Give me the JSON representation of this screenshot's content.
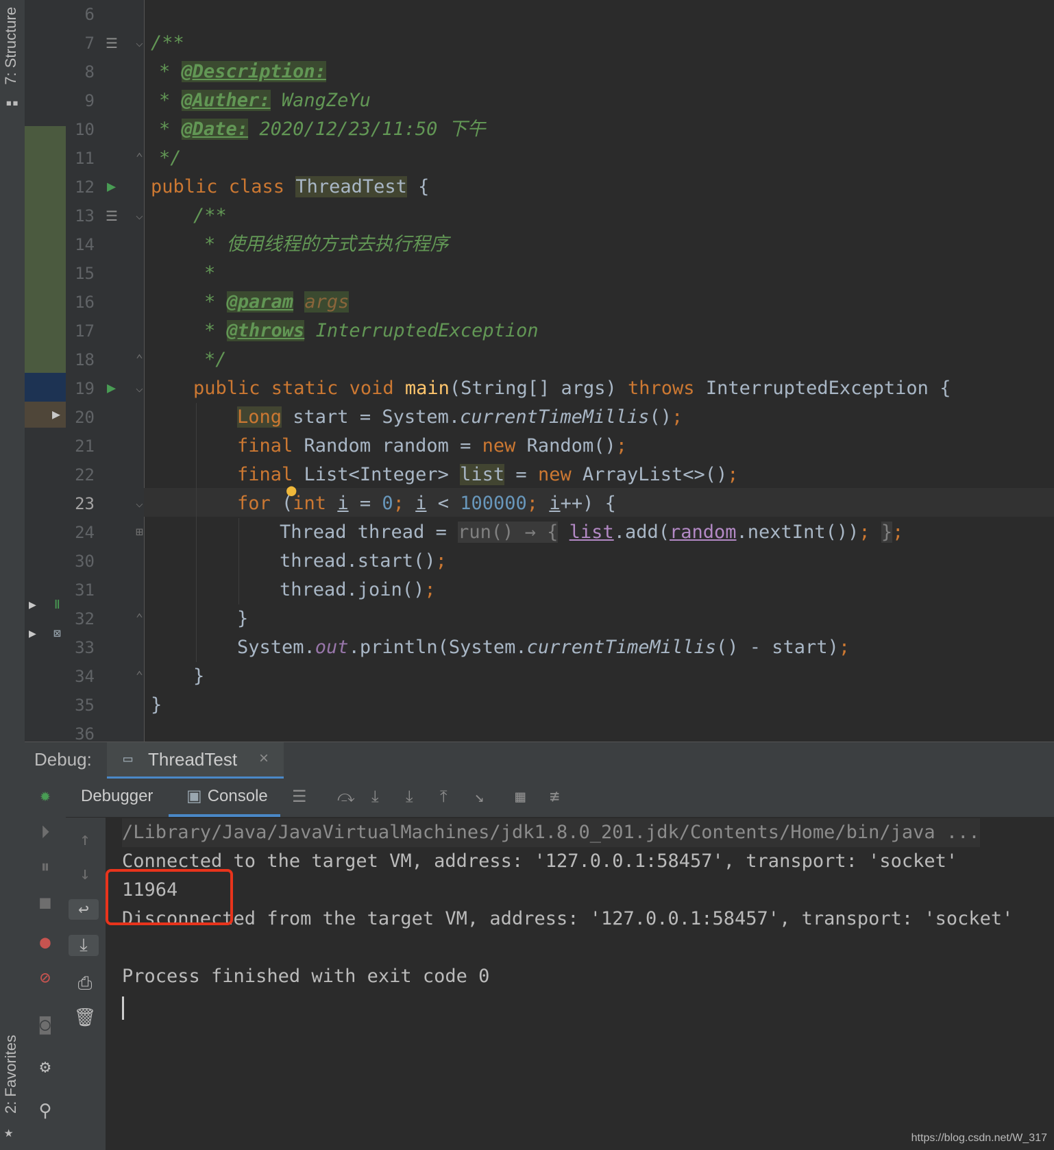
{
  "sidebar": {
    "structure_label": "7: Structure",
    "favorites_label": "2: Favorites"
  },
  "editor": {
    "line_numbers": [
      "6",
      "7",
      "8",
      "9",
      "10",
      "11",
      "12",
      "13",
      "14",
      "15",
      "16",
      "17",
      "18",
      "19",
      "20",
      "21",
      "22",
      "23",
      "24",
      "30",
      "31",
      "32",
      "33",
      "34",
      "35",
      "36"
    ],
    "current_line": "23",
    "code": {
      "l7": "/**",
      "l8_tag": "@Description:",
      "l9_tag": "@Auther:",
      "l9_val": "WangZeYu",
      "l10_tag": "@Date:",
      "l10_val": "2020/12/23/11:50 下午",
      "l11": "*/",
      "l12_kw": "public class",
      "l12_name": "ThreadTest",
      "l13": "/**",
      "l14": "* 使用线程的方式去执行程序",
      "l15": "*",
      "l16_tag": "@param",
      "l16_val": "args",
      "l17_tag": "@throws",
      "l17_val": "InterruptedException",
      "l18": "*/",
      "l19_kw": "public static void",
      "l19_fn": "main",
      "l19_sig": "(String[] args)",
      "l19_throws": "throws",
      "l19_exc": "InterruptedException {",
      "l20_type": "Long",
      "l20_rest": " start = System.",
      "l20_call": "currentTimeMillis",
      "l20_end": "()",
      "l21_kw": "final",
      "l21_mid": " Random random = ",
      "l21_new": "new",
      "l21_end": " Random()",
      "l22_kw": "final",
      "l22_mid": " List<Integer> ",
      "l22_var": "list",
      "l22_eq": " = ",
      "l22_new": "new",
      "l22_end": " ArrayList<>()",
      "l23_for": "for",
      "l23_int": "int",
      "l23_i": "i",
      "l23_zero": "0",
      "l23_max": "100000",
      "l24_a": "Thread thread = ",
      "l24_lambda": "run() → {",
      "l24_list": "list",
      "l24_add": ".add(",
      "l24_random": "random",
      "l24_next": ".nextInt())",
      "l24_close": "}",
      "l30": "thread.start()",
      "l31": "thread.join()",
      "l32": "}",
      "l33_a": "System.",
      "l33_out": "out",
      "l33_b": ".println(System.",
      "l33_call": "currentTimeMillis",
      "l33_c": "() - start)",
      "l34": "}",
      "l35": "}"
    }
  },
  "debug": {
    "label": "Debug:",
    "tab_title": "ThreadTest",
    "tab_close": "×",
    "subtabs": {
      "debugger": "Debugger",
      "console": "Console"
    },
    "console_lines": [
      "/Library/Java/JavaVirtualMachines/jdk1.8.0_201.jdk/Contents/Home/bin/java ...",
      "Connected to the target VM, address: '127.0.0.1:58457', transport: 'socket'",
      "11964",
      "Disconnected from the target VM, address: '127.0.0.1:58457', transport: 'socket'",
      "",
      "Process finished with exit code 0"
    ]
  },
  "watermark": "https://blog.csdn.net/W_317",
  "colors": {
    "highlight_box": "#e8341c",
    "accent": "#4a88c7"
  }
}
